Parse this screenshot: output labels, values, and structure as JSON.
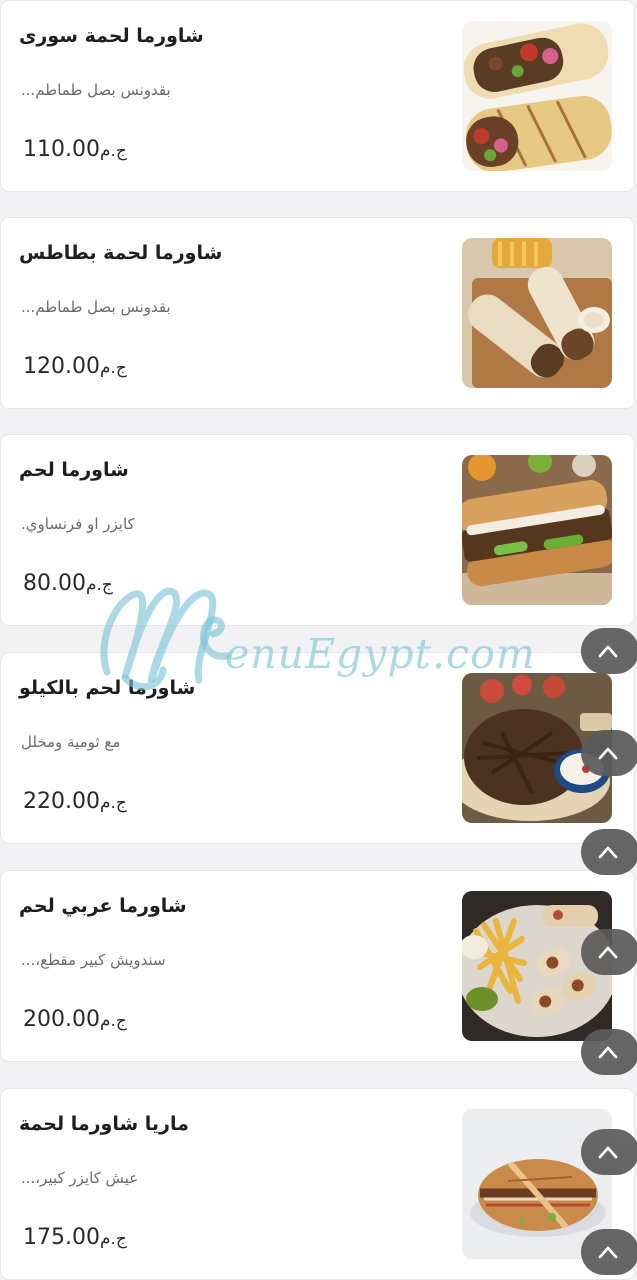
{
  "currency": "ج.م",
  "items": [
    {
      "name": "شاورما لحمة سورى",
      "desc": "بقدونس بصل طماطم...",
      "price": "110.00"
    },
    {
      "name": "شاورما لحمة بطاطس",
      "desc": "بقدونس بصل طماطم...",
      "price": "120.00"
    },
    {
      "name": "شاورما لحم",
      "desc": "كايزر او فرنساوي.",
      "price": "80.00"
    },
    {
      "name": "شاورما لحم بالكيلو",
      "desc": "مع ثومية ومخلل",
      "price": "220.00"
    },
    {
      "name": "شاورما عربي لحم",
      "desc": "سندويش كبير مقطع،...",
      "price": "200.00"
    },
    {
      "name": "ماريا شاورما لحمة",
      "desc": "عيش كايزر كبير،...",
      "price": "175.00"
    }
  ],
  "watermark": {
    "text": "enuEgypt.com"
  },
  "colors": {
    "card_bg": "#ffffff",
    "page_bg": "#f2f2f4",
    "scroll_button": "#5b5b5b",
    "watermark": "#78c3d7"
  },
  "icons": {
    "scroll_top": "chevron-up-icon"
  }
}
